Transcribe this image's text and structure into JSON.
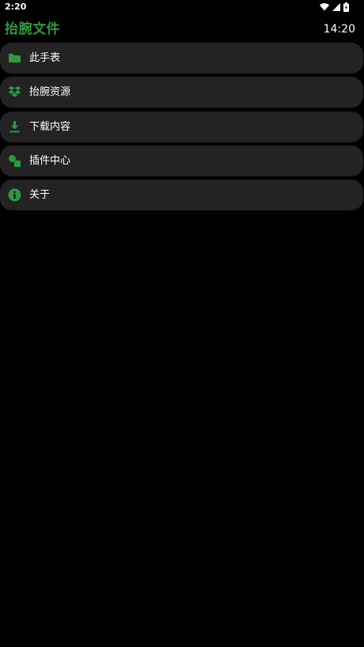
{
  "status_bar": {
    "time": "2:20"
  },
  "header": {
    "title": "抬腕文件",
    "clock": "14:20"
  },
  "menu": {
    "items": [
      {
        "label": "此手表",
        "icon": "folder-icon"
      },
      {
        "label": "抬腕资源",
        "icon": "dropbox-icon"
      },
      {
        "label": "下载内容",
        "icon": "download-icon"
      },
      {
        "label": "插件中心",
        "icon": "plugin-icon"
      },
      {
        "label": "关于",
        "icon": "info-icon"
      }
    ]
  },
  "colors": {
    "accent": "#2e9a3e",
    "card": "#232323",
    "background": "#000000"
  }
}
